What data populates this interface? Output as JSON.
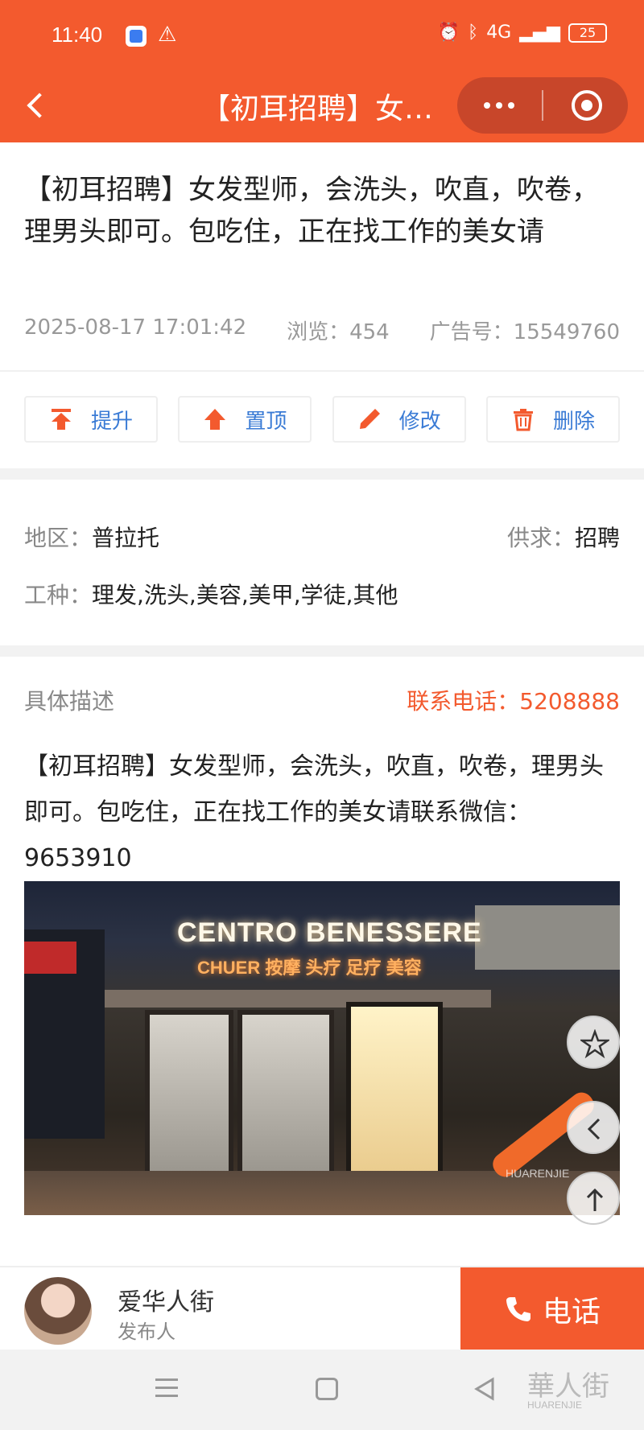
{
  "status_bar": {
    "time": "11:40",
    "network": "4G",
    "battery": "25"
  },
  "header": {
    "title": "【初耳招聘】女发型师，会洗头，吹直，吹卷，理男头即可。包吃住，正在找工作的美女请"
  },
  "post": {
    "title": "【初耳招聘】女发型师，会洗头，吹直，吹卷，理男头即可。包吃住，正在找工作的美女请",
    "datetime": "2025-08-17 17:01:42",
    "views_label": "浏览：454",
    "ad_no_label": "广告号：15549760"
  },
  "actions": [
    {
      "label": "提升",
      "icon": "boost-icon"
    },
    {
      "label": "置顶",
      "icon": "pin-top-icon"
    },
    {
      "label": "修改",
      "icon": "pencil-icon"
    },
    {
      "label": "删除",
      "icon": "trash-icon"
    }
  ],
  "info": {
    "region_label": "地区：",
    "region_value": "普拉托",
    "supply_label": "供求：",
    "supply_value": "招聘",
    "trade_label": "工种：",
    "trade_value": "理发,洗头,美容,美甲,学徒,其他"
  },
  "description": {
    "heading": "具体描述",
    "phone": "联系电话：5208888",
    "body": "【初耳招聘】女发型师，会洗头，吹直，吹卷，理男头即可。包吃住，正在找工作的美女请联系微信：9653910"
  },
  "photo": {
    "sign": "CENTRO BENESSERE",
    "sign_sub": "CHUER 按摩 头疗 足疗 美容",
    "watermark": "HUARENJIE"
  },
  "publisher": {
    "name": "爱华人街",
    "role": "发布人"
  },
  "call": {
    "label": "电话"
  },
  "colors": {
    "accent": "#f35a2e",
    "link": "#3a7bd5"
  }
}
